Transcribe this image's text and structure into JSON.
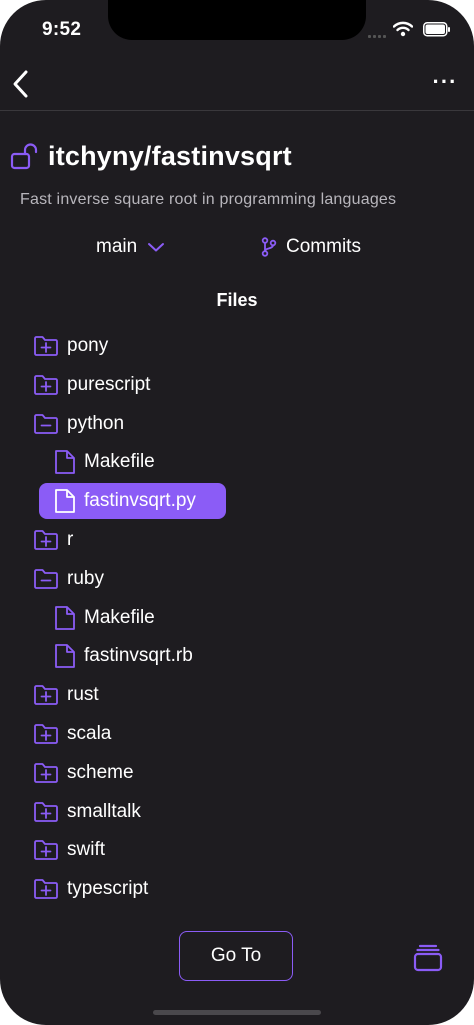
{
  "status_bar": {
    "time": "9:52"
  },
  "nav": {
    "back_icon": "chevron-left-icon",
    "more_label": "···"
  },
  "repo": {
    "icon": "unlock-icon",
    "title": "itchyny/fastinvsqrt",
    "description": "Fast inverse square root in programming languages"
  },
  "branch": {
    "label": "main",
    "icon": "chevron-down-icon"
  },
  "commits": {
    "label": "Commits",
    "icon": "git-branch-icon"
  },
  "files": {
    "title": "Files",
    "items": [
      {
        "label": "pony",
        "type": "folder-collapsed"
      },
      {
        "label": "purescript",
        "type": "folder-collapsed"
      },
      {
        "label": "python",
        "type": "folder-expanded"
      },
      {
        "label": "Makefile",
        "type": "file"
      },
      {
        "label": "fastinvsqrt.py",
        "type": "file",
        "selected": true
      },
      {
        "label": "r",
        "type": "folder-collapsed"
      },
      {
        "label": "ruby",
        "type": "folder-expanded"
      },
      {
        "label": "Makefile",
        "type": "file"
      },
      {
        "label": "fastinvsqrt.rb",
        "type": "file"
      },
      {
        "label": "rust",
        "type": "folder-collapsed"
      },
      {
        "label": "scala",
        "type": "folder-collapsed"
      },
      {
        "label": "scheme",
        "type": "folder-collapsed"
      },
      {
        "label": "smalltalk",
        "type": "folder-collapsed"
      },
      {
        "label": "swift",
        "type": "folder-collapsed"
      },
      {
        "label": "typescript",
        "type": "folder-collapsed"
      }
    ]
  },
  "footer": {
    "goto_label": "Go To",
    "stack_icon": "stack-icon"
  },
  "colors": {
    "accent": "#8b5cf6",
    "background": "#1e1c20",
    "text": "#ffffff",
    "muted": "#b8b6bc"
  }
}
